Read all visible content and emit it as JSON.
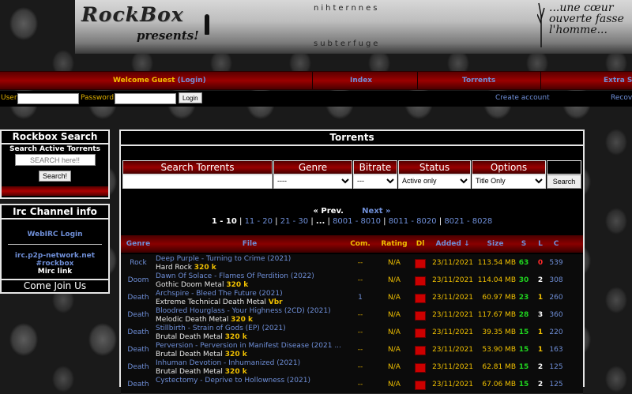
{
  "banner": {
    "logo": "RockBox",
    "presents": "presents!",
    "title": "nihternnes",
    "subtitle": "subterfuge",
    "quote": "...une cœur ouverte fasse l'homme..."
  },
  "nav": {
    "welcome": "Welcome Guest",
    "login_link": "(Login)",
    "index": "Index",
    "torrents": "Torrents",
    "extra": "Extra St"
  },
  "login": {
    "user_label": "User:",
    "password_label": "Password:",
    "button": "Login",
    "create_account": "Create account",
    "recover": "Recove"
  },
  "rockbox_search": {
    "title": "Rockbox Search",
    "subtitle": "Search Active Torrents",
    "placeholder": "SEARCH here!!",
    "button": "Search!"
  },
  "irc": {
    "title": "Irc Channel info",
    "webirc": "WebIRC Login",
    "server": "irc.p2p-network.net",
    "channel": "#rockbox",
    "mirc": "Mirc link",
    "join": "Come Join Us"
  },
  "torrents": {
    "title": "Torrents",
    "search_headers": [
      "Search Torrents",
      "Genre",
      "Bitrate",
      "Status",
      "Options"
    ],
    "genre_value": "----",
    "bitrate_value": "---",
    "status_value": "Active only",
    "options_value": "Title Only",
    "search_button": "Search",
    "prev": "« Prev.",
    "next": "Next »",
    "pages": [
      "1 - 10",
      "11 - 20",
      "21 - 30",
      "...",
      "8001 - 8010",
      "8011 - 8020",
      "8021 - 8028"
    ],
    "sep": "|",
    "columns": {
      "genre": "Genre",
      "file": "File",
      "com": "Com.",
      "rating": "Rating",
      "dl": "Dl",
      "added": "Added ↓",
      "size": "Size",
      "s": "S",
      "l": "L",
      "c": "C"
    },
    "rows": [
      {
        "genre": "Rock",
        "name": "Deep Purple - Turning to Crime (2021)",
        "sub": "Hard Rock",
        "bitrate": "320 k",
        "com": "--",
        "rating": "N/A",
        "added": "23/11/2021",
        "size": "113.54 MB",
        "s": "63",
        "l": "0",
        "c": "539"
      },
      {
        "genre": "Doom",
        "name": "Dawn Of Solace - Flames Of Perdition (2022)",
        "sub": "Gothic Doom Metal",
        "bitrate": "320 k",
        "com": "--",
        "rating": "N/A",
        "added": "23/11/2021",
        "size": "114.04 MB",
        "s": "30",
        "l": "2",
        "c": "308"
      },
      {
        "genre": "Death",
        "name": "Archspire - Bleed The Future (2021)",
        "sub": "Extreme Technical Death Metal",
        "bitrate": "Vbr",
        "com": "1",
        "rating": "N/A",
        "added": "23/11/2021",
        "size": "60.97 MB",
        "s": "23",
        "l": "1",
        "c": "260"
      },
      {
        "genre": "Death",
        "name": "Bloodred Hourglass - Your Highness (2CD) (2021)",
        "sub": "Melodic Death Metal",
        "bitrate": "320 k",
        "com": "--",
        "rating": "N/A",
        "added": "23/11/2021",
        "size": "117.67 MB",
        "s": "28",
        "l": "3",
        "c": "360"
      },
      {
        "genre": "Death",
        "name": "Stillbirth - Strain of Gods (EP) (2021)",
        "sub": "Brutal Death Metal",
        "bitrate": "320 k",
        "com": "--",
        "rating": "N/A",
        "added": "23/11/2021",
        "size": "39.35 MB",
        "s": "15",
        "l": "1",
        "c": "220"
      },
      {
        "genre": "Death",
        "name": "Perversion - Perversion in Manifest Disease (2021 ...",
        "sub": "Brutal Death Metal",
        "bitrate": "320 k",
        "com": "--",
        "rating": "N/A",
        "added": "23/11/2021",
        "size": "53.90 MB",
        "s": "15",
        "l": "1",
        "c": "163"
      },
      {
        "genre": "Death",
        "name": "Inhuman Devotion - Inhumanized (2021)",
        "sub": "Brutal Death Metal",
        "bitrate": "320 k",
        "com": "--",
        "rating": "N/A",
        "added": "23/11/2021",
        "size": "62.81 MB",
        "s": "15",
        "l": "2",
        "c": "125"
      },
      {
        "genre": "Death",
        "name": "Cystectomy - Deprive to Hollowness (2021)",
        "sub": "",
        "bitrate": "",
        "com": "--",
        "rating": "N/A",
        "added": "23/11/2021",
        "size": "67.06 MB",
        "s": "15",
        "l": "2",
        "c": "125"
      }
    ]
  }
}
